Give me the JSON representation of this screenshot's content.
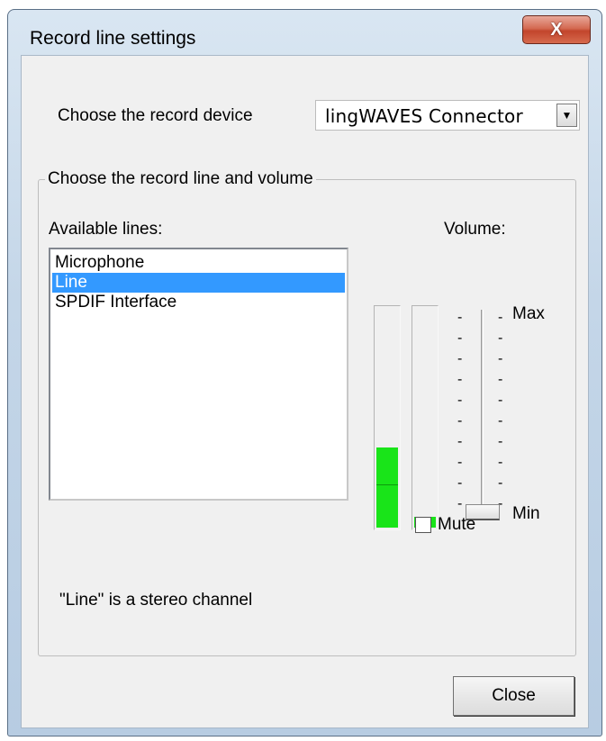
{
  "window": {
    "title": "Record line settings",
    "close_glyph": "X"
  },
  "device": {
    "label": "Choose the record device",
    "selected": "lingWAVES Connector",
    "arrow_icon": "▼"
  },
  "group": {
    "legend": "Choose the record line and volume",
    "available_label": "Available lines:",
    "volume_label": "Volume:",
    "lines": [
      "Microphone",
      "Line",
      "SPDIF Interface"
    ],
    "selected_index": 1,
    "status_text": "\"Line\" is a stereo channel"
  },
  "volume": {
    "max_label": "Max",
    "min_label": "Min",
    "slider_level_fraction": 0.0,
    "meter_left_level_fraction": 0.36,
    "meter_right_level_fraction": 0.05,
    "tick_glyph": "-",
    "mute_label": "Mute",
    "mute_checked": false
  },
  "buttons": {
    "close_label": "Close"
  },
  "colors": {
    "selection": "#3399ff",
    "meter_green": "#19e419",
    "close_red": "#c2452c"
  }
}
